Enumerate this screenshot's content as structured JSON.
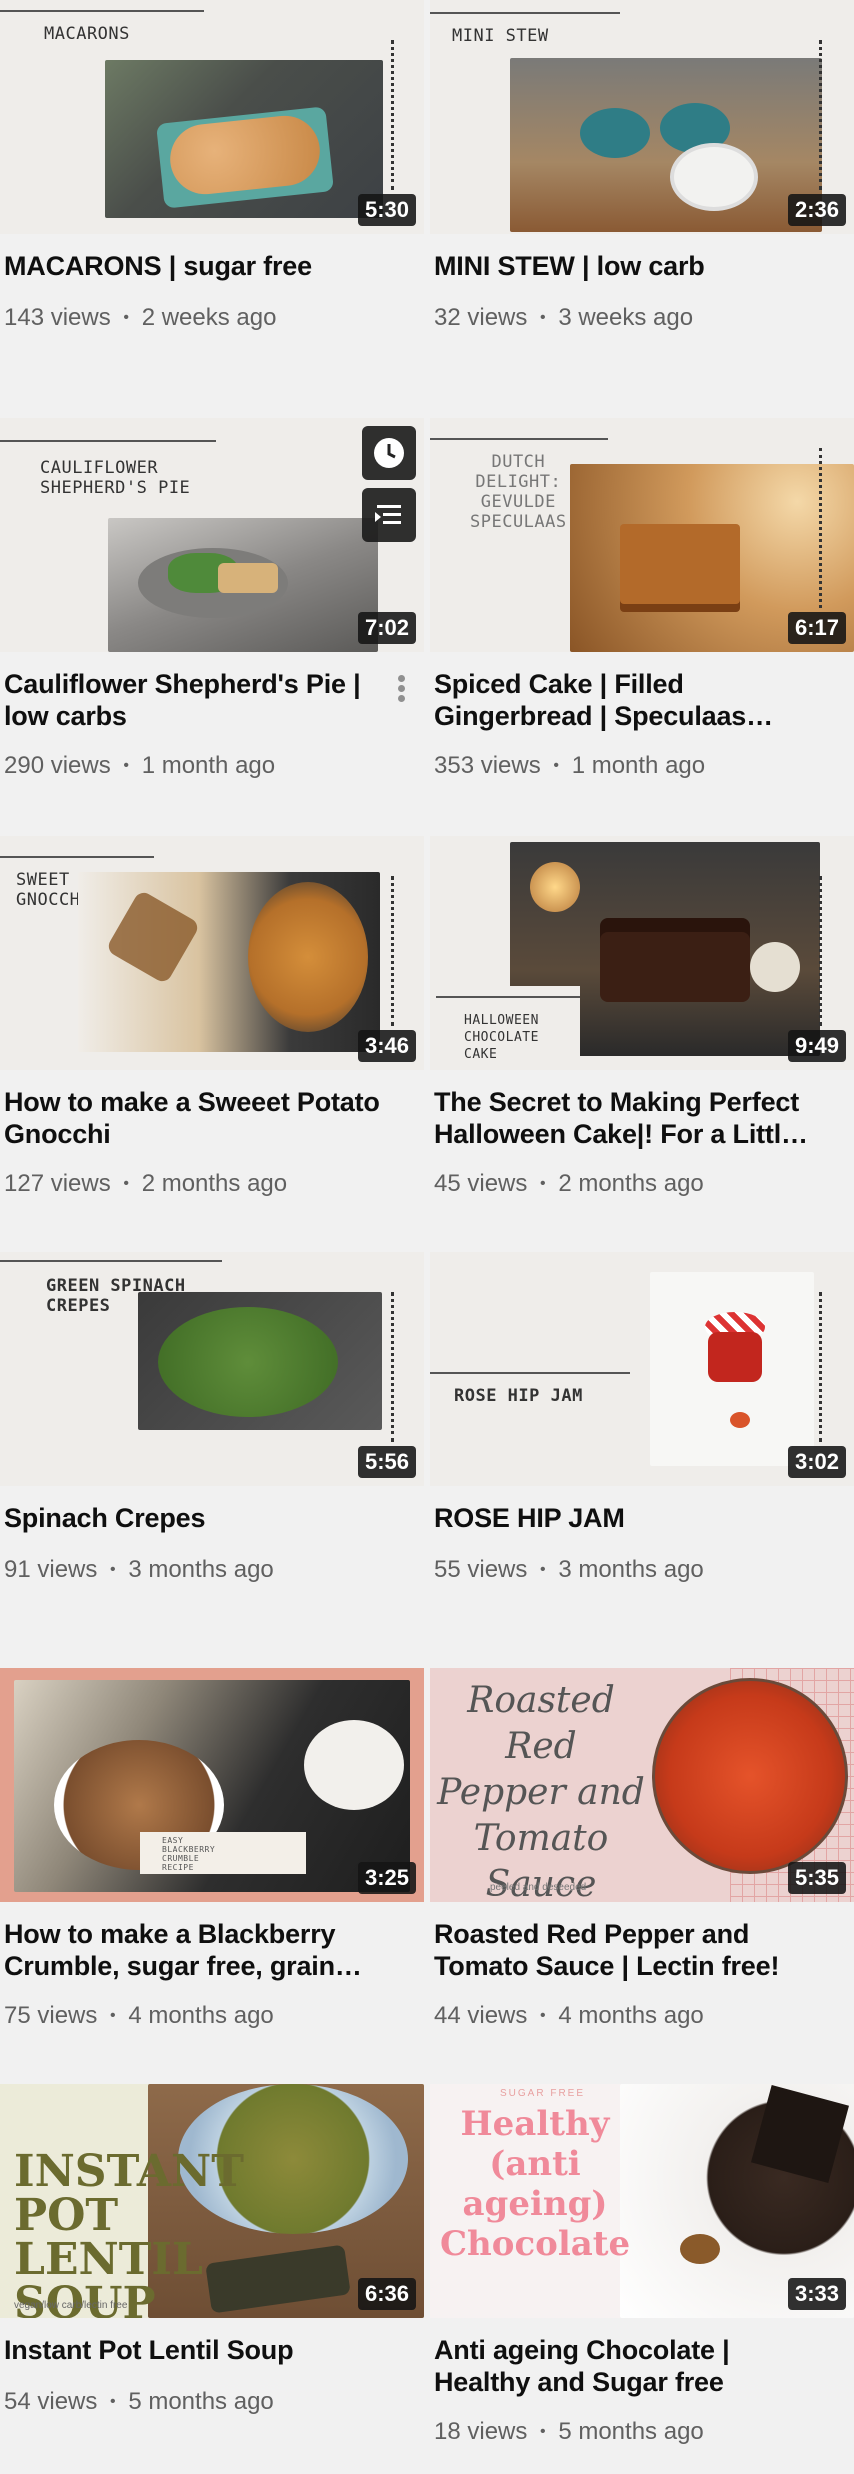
{
  "videos": [
    {
      "thumb_label": "MACARONS",
      "duration": "5:30",
      "title": "MACARONS | sugar free",
      "views": "143 views",
      "age": "2 weeks ago"
    },
    {
      "thumb_label": "MINI STEW",
      "duration": "2:36",
      "title": "MINI STEW | low carb",
      "views": "32 views",
      "age": "3 weeks ago"
    },
    {
      "thumb_label": "CAULIFLOWER\nSHEPHERD'S PIE",
      "duration": "7:02",
      "title": "Cauliflower Shepherd's Pie | low carbs",
      "views": "290 views",
      "age": "1 month ago"
    },
    {
      "thumb_label": "DUTCH\nDELIGHT:\nGEVULDE\nSPECULAAS",
      "duration": "6:17",
      "title": "Spiced Cake | Filled Gingerbread | Speculaas…",
      "views": "353 views",
      "age": "1 month ago"
    },
    {
      "thumb_label": "SWEET POTATO\nGNOCCHI",
      "duration": "3:46",
      "title": "How to make a Sweeet Potato Gnocchi",
      "views": "127 views",
      "age": "2 months ago"
    },
    {
      "thumb_label": "HALLOWEEN\nCHOCOLATE\nCAKE",
      "duration": "9:49",
      "title": "The Secret to Making Perfect Halloween Cake|! For a Littl…",
      "views": "45 views",
      "age": "2 months ago"
    },
    {
      "thumb_label": "GREEN SPINACH\nCREPES",
      "duration": "5:56",
      "title": "Spinach Crepes",
      "views": "91 views",
      "age": "3 months ago"
    },
    {
      "thumb_label": "ROSE HIP JAM",
      "duration": "3:02",
      "title": "ROSE HIP JAM",
      "views": "55 views",
      "age": "3 months ago"
    },
    {
      "thumb_label": "EASY\nBLACKBERRY\nCRUMBLE\nRECIPE",
      "duration": "3:25",
      "title": "How to make a Blackberry Crumble, sugar free, grain…",
      "views": "75 views",
      "age": "4 months ago"
    },
    {
      "thumb_label": "Roasted Red\nPepper and\nTomato\nSauce",
      "thumb_sublabel": "peeled and deseeded",
      "duration": "5:35",
      "title": "Roasted Red Pepper and Tomato Sauce | Lectin free!",
      "views": "44 views",
      "age": "4 months ago"
    },
    {
      "thumb_label": "INSTANT\nPOT\nLENTIL\nSOUP",
      "thumb_sublabel": "vegan/low carb/lectin free",
      "duration": "6:36",
      "title": "Instant Pot Lentil Soup",
      "views": "54 views",
      "age": "5 months ago"
    },
    {
      "thumb_label": "Healthy\n(anti\nageing)\nChocolate",
      "thumb_sublabel": "SUGAR FREE",
      "duration": "3:33",
      "title": "Anti ageing Chocolate | Healthy and Sugar free",
      "views": "18 views",
      "age": "5 months ago"
    }
  ],
  "meta_separator": "•",
  "icons": {
    "watch_later": "clock-icon",
    "add_to_queue": "queue-icon",
    "more": "more-vert-icon"
  },
  "colors": {
    "background": "#f1f1f1",
    "title": "#0f0f0f",
    "meta": "#606060",
    "duration_bg": "#141414"
  }
}
